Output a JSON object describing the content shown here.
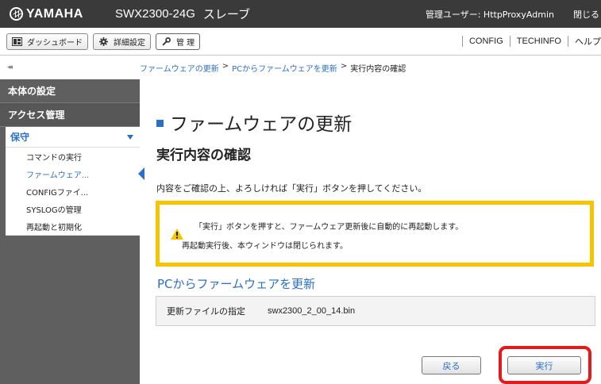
{
  "topbar": {
    "brand": "YAMAHA",
    "model": "SWX2300-24G",
    "mode": "スレーブ",
    "user": "管理ユーザー: HttpProxyAdmin",
    "close": "閉じる"
  },
  "toolbar": {
    "dashboard": "ダッシュボード",
    "advanced": "詳細設定",
    "manage": "管 理",
    "config": "CONFIG",
    "techinfo": "TECHINFO",
    "help": "ヘルプ"
  },
  "breadcrumb": {
    "item1": "ファームウェアの更新",
    "item2": "PCからファームウェアを更新",
    "current": "実行内容の確認",
    "sep": ">",
    "collapse": "◂◂"
  },
  "sidebar": {
    "sections": [
      "本体の設定",
      "アクセス管理"
    ],
    "open_section": "保守",
    "items": [
      "コマンドの実行",
      "ファームウェア...",
      "CONFIGファイ...",
      "SYSLOGの管理",
      "再起動と初期化"
    ],
    "active_index": 1
  },
  "main": {
    "title": "ファームウェアの更新",
    "subtitle": "実行内容の確認",
    "description": "内容をご確認の上、よろしければ「実行」ボタンを押してください。",
    "warning_line1": "「実行」ボタンを押すと、ファームウェア更新後に自動的に再起動します。",
    "warning_line2": "再起動実行後、本ウィンドウは閉じられます。",
    "section_title": "PCからファームウェアを更新",
    "file_label": "更新ファイルの指定",
    "file_value": "swx2300_2_00_14.bin",
    "back_button": "戻る",
    "execute_button": "実行"
  },
  "colors": {
    "accent": "#2a6fc9",
    "warning_border": "#f7c500",
    "highlight": "#e41b1b",
    "sidebar": "#5f5f5f",
    "topbar": "#3a3a3a"
  }
}
